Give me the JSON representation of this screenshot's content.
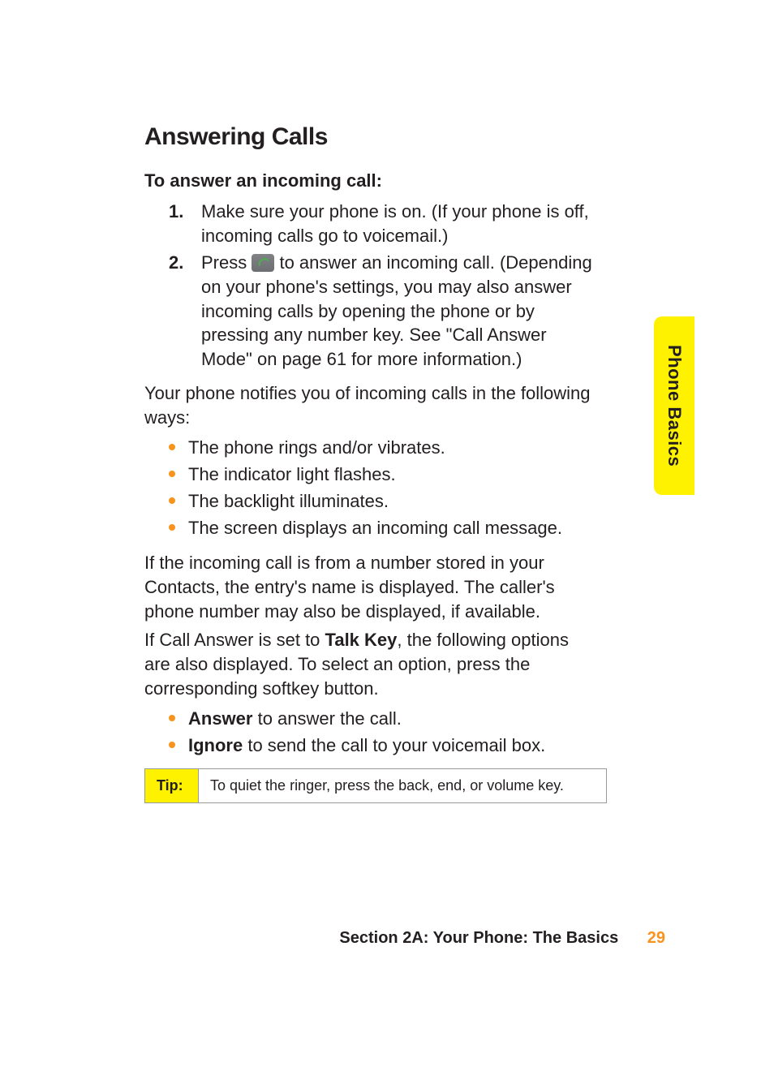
{
  "heading": "Answering Calls",
  "subhead": "To answer an incoming call:",
  "step1_num": "1.",
  "step1_text": "Make sure your phone is on. (If your phone is off, incoming calls go to voicemail.)",
  "step2_num": "2.",
  "step2_pre": "Press ",
  "step2_post": " to answer an incoming call. (Depending on your phone's settings, you may also answer incoming calls by opening the phone or by pressing any number key. See \"Call Answer Mode\" on page 61 for more information.)",
  "notify_para": "Your phone notifies you of incoming calls in the following ways:",
  "notify_list": [
    "The phone rings and/or vibrates.",
    "The indicator light flashes.",
    "The backlight illuminates.",
    "The screen displays an incoming call message."
  ],
  "contacts_para": "If the incoming call is from a number stored in your Contacts, the entry's name is displayed. The caller's phone number may also be displayed, if available.",
  "talkkey_pre": "If Call Answer is set to ",
  "talkkey_bold": "Talk Key",
  "talkkey_post": ", the following options are also displayed. To select an option, press the corresponding softkey button.",
  "option_answer_bold": "Answer",
  "option_answer_rest": " to answer the call.",
  "option_ignore_bold": "Ignore",
  "option_ignore_rest": " to send the call to your voicemail box.",
  "tip_label": "Tip:",
  "tip_text": "To quiet the ringer, press the back, end, or volume key.",
  "side_tab": "Phone Basics",
  "footer_section": "Section 2A: Your Phone: The Basics",
  "footer_page": "29"
}
